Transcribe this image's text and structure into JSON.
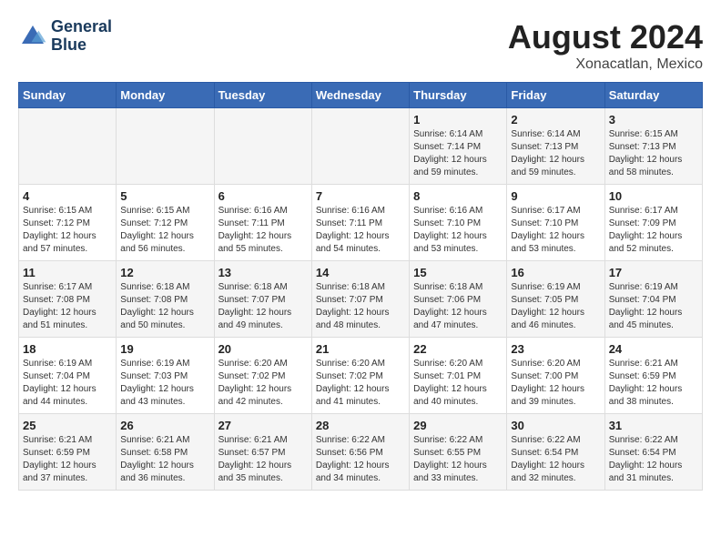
{
  "header": {
    "logo_line1": "General",
    "logo_line2": "Blue",
    "month_year": "August 2024",
    "location": "Xonacatlan, Mexico"
  },
  "weekdays": [
    "Sunday",
    "Monday",
    "Tuesday",
    "Wednesday",
    "Thursday",
    "Friday",
    "Saturday"
  ],
  "weeks": [
    [
      {
        "day": "",
        "info": ""
      },
      {
        "day": "",
        "info": ""
      },
      {
        "day": "",
        "info": ""
      },
      {
        "day": "",
        "info": ""
      },
      {
        "day": "1",
        "info": "Sunrise: 6:14 AM\nSunset: 7:14 PM\nDaylight: 12 hours\nand 59 minutes."
      },
      {
        "day": "2",
        "info": "Sunrise: 6:14 AM\nSunset: 7:13 PM\nDaylight: 12 hours\nand 59 minutes."
      },
      {
        "day": "3",
        "info": "Sunrise: 6:15 AM\nSunset: 7:13 PM\nDaylight: 12 hours\nand 58 minutes."
      }
    ],
    [
      {
        "day": "4",
        "info": "Sunrise: 6:15 AM\nSunset: 7:12 PM\nDaylight: 12 hours\nand 57 minutes."
      },
      {
        "day": "5",
        "info": "Sunrise: 6:15 AM\nSunset: 7:12 PM\nDaylight: 12 hours\nand 56 minutes."
      },
      {
        "day": "6",
        "info": "Sunrise: 6:16 AM\nSunset: 7:11 PM\nDaylight: 12 hours\nand 55 minutes."
      },
      {
        "day": "7",
        "info": "Sunrise: 6:16 AM\nSunset: 7:11 PM\nDaylight: 12 hours\nand 54 minutes."
      },
      {
        "day": "8",
        "info": "Sunrise: 6:16 AM\nSunset: 7:10 PM\nDaylight: 12 hours\nand 53 minutes."
      },
      {
        "day": "9",
        "info": "Sunrise: 6:17 AM\nSunset: 7:10 PM\nDaylight: 12 hours\nand 53 minutes."
      },
      {
        "day": "10",
        "info": "Sunrise: 6:17 AM\nSunset: 7:09 PM\nDaylight: 12 hours\nand 52 minutes."
      }
    ],
    [
      {
        "day": "11",
        "info": "Sunrise: 6:17 AM\nSunset: 7:08 PM\nDaylight: 12 hours\nand 51 minutes."
      },
      {
        "day": "12",
        "info": "Sunrise: 6:18 AM\nSunset: 7:08 PM\nDaylight: 12 hours\nand 50 minutes."
      },
      {
        "day": "13",
        "info": "Sunrise: 6:18 AM\nSunset: 7:07 PM\nDaylight: 12 hours\nand 49 minutes."
      },
      {
        "day": "14",
        "info": "Sunrise: 6:18 AM\nSunset: 7:07 PM\nDaylight: 12 hours\nand 48 minutes."
      },
      {
        "day": "15",
        "info": "Sunrise: 6:18 AM\nSunset: 7:06 PM\nDaylight: 12 hours\nand 47 minutes."
      },
      {
        "day": "16",
        "info": "Sunrise: 6:19 AM\nSunset: 7:05 PM\nDaylight: 12 hours\nand 46 minutes."
      },
      {
        "day": "17",
        "info": "Sunrise: 6:19 AM\nSunset: 7:04 PM\nDaylight: 12 hours\nand 45 minutes."
      }
    ],
    [
      {
        "day": "18",
        "info": "Sunrise: 6:19 AM\nSunset: 7:04 PM\nDaylight: 12 hours\nand 44 minutes."
      },
      {
        "day": "19",
        "info": "Sunrise: 6:19 AM\nSunset: 7:03 PM\nDaylight: 12 hours\nand 43 minutes."
      },
      {
        "day": "20",
        "info": "Sunrise: 6:20 AM\nSunset: 7:02 PM\nDaylight: 12 hours\nand 42 minutes."
      },
      {
        "day": "21",
        "info": "Sunrise: 6:20 AM\nSunset: 7:02 PM\nDaylight: 12 hours\nand 41 minutes."
      },
      {
        "day": "22",
        "info": "Sunrise: 6:20 AM\nSunset: 7:01 PM\nDaylight: 12 hours\nand 40 minutes."
      },
      {
        "day": "23",
        "info": "Sunrise: 6:20 AM\nSunset: 7:00 PM\nDaylight: 12 hours\nand 39 minutes."
      },
      {
        "day": "24",
        "info": "Sunrise: 6:21 AM\nSunset: 6:59 PM\nDaylight: 12 hours\nand 38 minutes."
      }
    ],
    [
      {
        "day": "25",
        "info": "Sunrise: 6:21 AM\nSunset: 6:59 PM\nDaylight: 12 hours\nand 37 minutes."
      },
      {
        "day": "26",
        "info": "Sunrise: 6:21 AM\nSunset: 6:58 PM\nDaylight: 12 hours\nand 36 minutes."
      },
      {
        "day": "27",
        "info": "Sunrise: 6:21 AM\nSunset: 6:57 PM\nDaylight: 12 hours\nand 35 minutes."
      },
      {
        "day": "28",
        "info": "Sunrise: 6:22 AM\nSunset: 6:56 PM\nDaylight: 12 hours\nand 34 minutes."
      },
      {
        "day": "29",
        "info": "Sunrise: 6:22 AM\nSunset: 6:55 PM\nDaylight: 12 hours\nand 33 minutes."
      },
      {
        "day": "30",
        "info": "Sunrise: 6:22 AM\nSunset: 6:54 PM\nDaylight: 12 hours\nand 32 minutes."
      },
      {
        "day": "31",
        "info": "Sunrise: 6:22 AM\nSunset: 6:54 PM\nDaylight: 12 hours\nand 31 minutes."
      }
    ]
  ]
}
